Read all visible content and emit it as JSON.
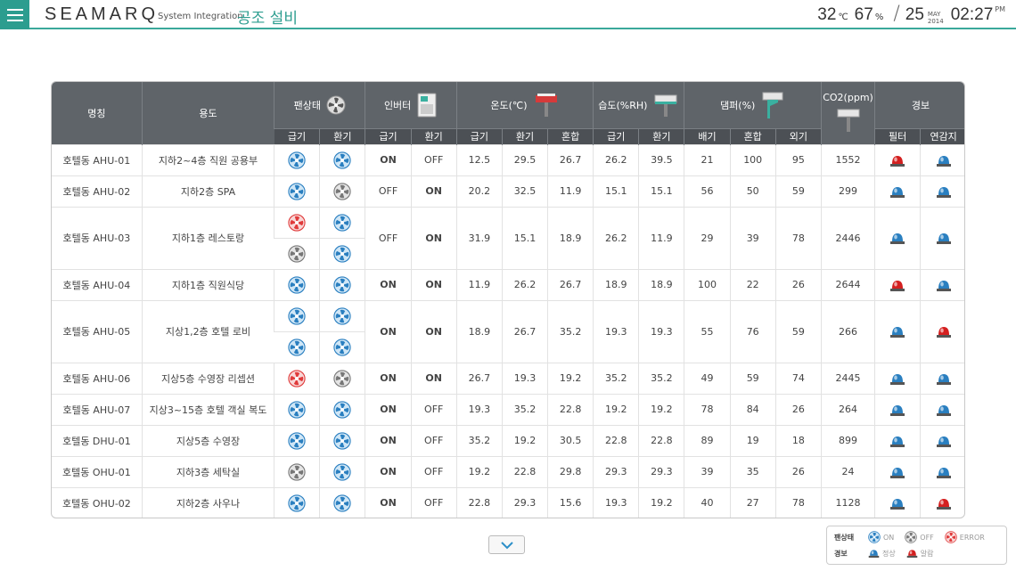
{
  "header": {
    "brand": "SEAMARQ",
    "subtitle": "System Integration",
    "title": "공조 설비",
    "temperature": "32",
    "temperature_unit": "℃",
    "humidity": "67",
    "humidity_unit": "%",
    "day": "25",
    "month": "MAY",
    "year": "2014",
    "time": "02:27",
    "ampm": "PM"
  },
  "colors": {
    "accent": "#2c9d8f",
    "header_bg": "#5f6469",
    "on": "#1e84c8",
    "off": "#a8a8a8",
    "fan_on": "#2a7fc0",
    "fan_off": "#777777",
    "fan_error": "#e03a3a",
    "siren_normal": "#2a7fc0",
    "siren_alarm": "#d42020"
  },
  "table": {
    "groups": {
      "name": "명칭",
      "usage": "용도",
      "fan": "팬상태",
      "inverter": "인버터",
      "temp": "온도(℃)",
      "humid": "습도(%RH)",
      "damper": "댐퍼(%)",
      "co2": "CO2(ppm)",
      "alarm": "경보"
    },
    "sub": {
      "supply": "급기",
      "return": "환기",
      "mix": "혼합",
      "exhaust": "배기",
      "outdoor": "외기",
      "filter": "필터",
      "link": "연감지"
    },
    "rows": [
      {
        "name": "호텔동 AHU-01",
        "usage": "지하2~4층 직원 공용부",
        "fans": [
          [
            "on",
            "on"
          ]
        ],
        "inv_s": "ON",
        "inv_r": "OFF",
        "t_s": "12.5",
        "t_r": "29.5",
        "t_m": "26.7",
        "h_s": "26.2",
        "h_r": "39.5",
        "d_e": "21",
        "d_m": "100",
        "d_o": "95",
        "co2": "1552",
        "a_f": "alarm",
        "a_l": "normal"
      },
      {
        "name": "호텔동 AHU-02",
        "usage": "지하2층 SPA",
        "fans": [
          [
            "on",
            "off"
          ]
        ],
        "inv_s": "OFF",
        "inv_r": "ON",
        "t_s": "20.2",
        "t_r": "32.5",
        "t_m": "11.9",
        "h_s": "15.1",
        "h_r": "15.1",
        "d_e": "56",
        "d_m": "50",
        "d_o": "59",
        "co2": "299",
        "a_f": "normal",
        "a_l": "normal"
      },
      {
        "name": "호텔동 AHU-03",
        "usage": "지하1층 레스토랑",
        "fans": [
          [
            "error",
            "on"
          ],
          [
            "off",
            "on"
          ]
        ],
        "inv_s": "OFF",
        "inv_r": "ON",
        "t_s": "31.9",
        "t_r": "15.1",
        "t_m": "18.9",
        "h_s": "26.2",
        "h_r": "11.9",
        "d_e": "29",
        "d_m": "39",
        "d_o": "78",
        "co2": "2446",
        "a_f": "normal",
        "a_l": "normal"
      },
      {
        "name": "호텔동 AHU-04",
        "usage": "지하1층 직원식당",
        "fans": [
          [
            "on",
            "on"
          ]
        ],
        "inv_s": "ON",
        "inv_r": "ON",
        "t_s": "11.9",
        "t_r": "26.2",
        "t_m": "26.7",
        "h_s": "18.9",
        "h_r": "18.9",
        "d_e": "100",
        "d_m": "22",
        "d_o": "26",
        "co2": "2644",
        "a_f": "alarm",
        "a_l": "normal"
      },
      {
        "name": "호텔동 AHU-05",
        "usage": "지상1,2층 호텔 로비",
        "fans": [
          [
            "on",
            "on"
          ],
          [
            "on",
            "on"
          ]
        ],
        "inv_s": "ON",
        "inv_r": "ON",
        "t_s": "18.9",
        "t_r": "26.7",
        "t_m": "35.2",
        "h_s": "19.3",
        "h_r": "19.3",
        "d_e": "55",
        "d_m": "76",
        "d_o": "59",
        "co2": "266",
        "a_f": "normal",
        "a_l": "alarm"
      },
      {
        "name": "호텔동 AHU-06",
        "usage": "지상5층 수영장 리셉션",
        "fans": [
          [
            "error",
            "off"
          ]
        ],
        "inv_s": "ON",
        "inv_r": "ON",
        "t_s": "26.7",
        "t_r": "19.3",
        "t_m": "19.2",
        "h_s": "35.2",
        "h_r": "35.2",
        "d_e": "49",
        "d_m": "59",
        "d_o": "74",
        "co2": "2445",
        "a_f": "normal",
        "a_l": "normal"
      },
      {
        "name": "호텔동 AHU-07",
        "usage": "지상3~15층 호텔 객실 복도",
        "fans": [
          [
            "on",
            "on"
          ]
        ],
        "inv_s": "ON",
        "inv_r": "OFF",
        "t_s": "19.3",
        "t_r": "35.2",
        "t_m": "22.8",
        "h_s": "19.2",
        "h_r": "19.2",
        "d_e": "78",
        "d_m": "84",
        "d_o": "26",
        "co2": "264",
        "a_f": "normal",
        "a_l": "normal"
      },
      {
        "name": "호텔동 DHU-01",
        "usage": "지상5층 수영장",
        "fans": [
          [
            "on",
            "on"
          ]
        ],
        "inv_s": "ON",
        "inv_r": "OFF",
        "t_s": "35.2",
        "t_r": "19.2",
        "t_m": "30.5",
        "h_s": "22.8",
        "h_r": "22.8",
        "d_e": "89",
        "d_m": "19",
        "d_o": "18",
        "co2": "899",
        "a_f": "normal",
        "a_l": "normal"
      },
      {
        "name": "호텔동 OHU-01",
        "usage": "지하3층 세탁실",
        "fans": [
          [
            "off",
            "on"
          ]
        ],
        "inv_s": "ON",
        "inv_r": "OFF",
        "t_s": "19.2",
        "t_r": "22.8",
        "t_m": "29.8",
        "h_s": "29.3",
        "h_r": "29.3",
        "d_e": "39",
        "d_m": "35",
        "d_o": "26",
        "co2": "24",
        "a_f": "normal",
        "a_l": "normal"
      },
      {
        "name": "호텔동 OHU-02",
        "usage": "지하2층 사우나",
        "fans": [
          [
            "on",
            "on"
          ]
        ],
        "inv_s": "ON",
        "inv_r": "OFF",
        "t_s": "22.8",
        "t_r": "29.3",
        "t_m": "15.6",
        "h_s": "19.3",
        "h_r": "19.2",
        "d_e": "40",
        "d_m": "27",
        "d_o": "78",
        "co2": "1128",
        "a_f": "normal",
        "a_l": "alarm"
      }
    ]
  },
  "legend": {
    "fan_title": "팬상태",
    "fan_on": "ON",
    "fan_off": "OFF",
    "fan_error": "ERROR",
    "alarm_title": "경보",
    "alarm_normal": "정상",
    "alarm_alarm": "알람"
  }
}
